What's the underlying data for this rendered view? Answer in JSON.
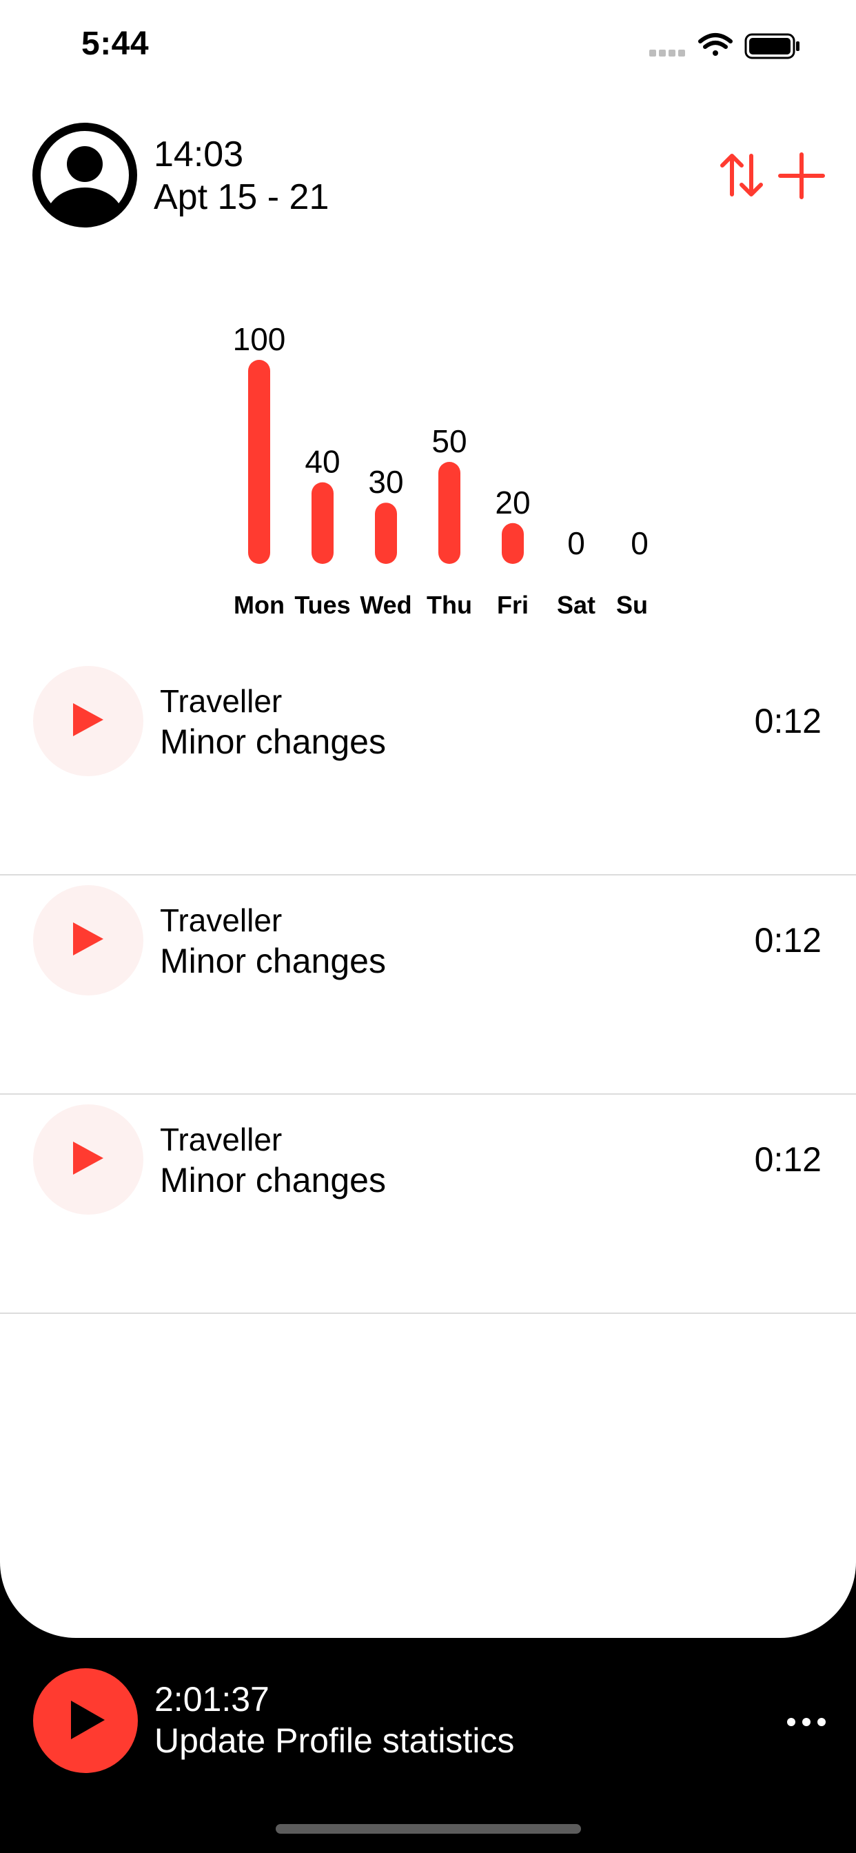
{
  "status_bar": {
    "time": "5:44",
    "icons": [
      "signal-icon",
      "wifi-icon",
      "battery-icon"
    ]
  },
  "header": {
    "time": "14:03",
    "date_range": "Apt 15 - 21",
    "icons": {
      "avatar": "person-circle-icon",
      "sort": "sort-arrows-icon",
      "add": "plus-icon"
    }
  },
  "colors": {
    "accent": "#ff3b30",
    "play_bg_light": "#fdf1f0",
    "divider": "#dcdcdc",
    "player_bg": "#000000"
  },
  "chart_data": {
    "type": "bar",
    "categories": [
      "Mon",
      "Tues",
      "Wed",
      "Thu",
      "Fri",
      "Sat",
      "Sun"
    ],
    "values": [
      100,
      40,
      30,
      50,
      20,
      0,
      0
    ],
    "ylim": [
      0,
      100
    ],
    "grid": false,
    "color": "#ff3b30"
  },
  "list": {
    "items": [
      {
        "subtitle": "Traveller",
        "title": "Minor changes",
        "duration": "0:12"
      },
      {
        "subtitle": "Traveller",
        "title": "Minor changes",
        "duration": "0:12"
      },
      {
        "subtitle": "Traveller",
        "title": "Minor changes",
        "duration": "0:12"
      }
    ]
  },
  "player": {
    "time": "2:01:37",
    "title": "Update Profile statistics",
    "more_icon": "ellipsis-icon"
  }
}
